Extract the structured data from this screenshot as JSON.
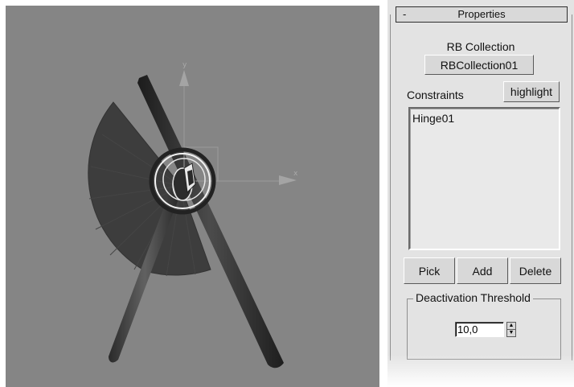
{
  "viewport": {
    "axis_x_label": "x",
    "axis_y_label": "y"
  },
  "properties": {
    "header_minus": "-",
    "title": "Properties",
    "rb_collection_label": "RB Collection",
    "rb_collection_button": "RBCollection01",
    "constraints_label": "Constraints",
    "highlight_button": "highlight",
    "constraints_list": [
      "Hinge01"
    ],
    "pick_button": "Pick",
    "add_button": "Add",
    "delete_button": "Delete",
    "deactivation_group_label": "Deactivation Threshold",
    "threshold_value": "10,0",
    "spinner_up": "▲",
    "spinner_down": "▼"
  }
}
